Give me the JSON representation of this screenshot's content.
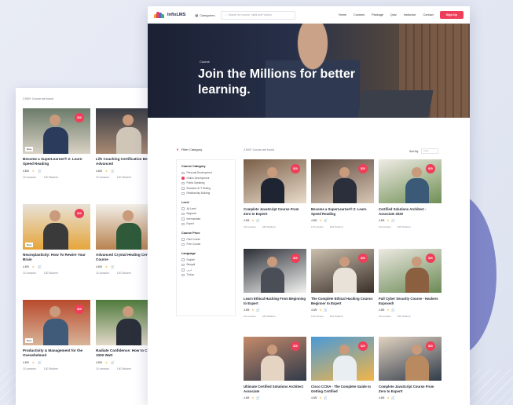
{
  "brand": {
    "name": "InfixLMS",
    "accent": "#ef3e59"
  },
  "nav": {
    "categories_label": "Categories",
    "search_placeholder": "Search for course, skills and Videos",
    "links": [
      "Home",
      "Courses",
      "Package",
      "Quiz",
      "Instructor",
      "Contact"
    ],
    "signup_label": "Sign Up"
  },
  "hero": {
    "subtitle": "Course",
    "title": "Join the Millions for better learning."
  },
  "filter": {
    "heading": "Filter Category",
    "groups": [
      {
        "title": "Course Category",
        "options": [
          "Personal Development",
          "Online Development",
          "Public Speaking",
          "Business & IT Writing",
          "Relationship Building"
        ]
      },
      {
        "title": "Level",
        "options": [
          "All Level",
          "Beginner",
          "Intermediate",
          "Expert"
        ]
      },
      {
        "title": "Course Price",
        "options": [
          "Paid Course",
          "Free Course"
        ]
      },
      {
        "title": "Language",
        "options": [
          "English",
          "Bengali",
          "عربي",
          "Turkçe"
        ]
      }
    ]
  },
  "front": {
    "count_text": "2,500+ Course are found",
    "sort_label": "Sort By",
    "sort_value": "Date",
    "courses": [
      {
        "title": "Complete JavaScript Course From Zero to Expert!",
        "rating": "4.8/5",
        "lessons": "10 Lessons",
        "students": "100 Student"
      },
      {
        "title": "Become a SuperLearner® 2: Learn Speed Reading",
        "rating": "4.8/5",
        "lessons": "10 Lessons",
        "students": "100 Student"
      },
      {
        "title": "Certified Solutions Architect - Associate 2020",
        "rating": "4.8/5",
        "lessons": "10 Lessons",
        "students": "100 Student"
      },
      {
        "title": "Learn Ethical Hacking From Beginning to Expert",
        "rating": "4.8/5",
        "lessons": "10 Lessons",
        "students": "100 Student"
      },
      {
        "title": "The Complete Ethical Hacking Course: Beginner to Expert",
        "rating": "4.8/5",
        "lessons": "10 Lessons",
        "students": "100 Student"
      },
      {
        "title": "Full Cyber Security Course - Hackers Exposed!",
        "rating": "4.8/5",
        "lessons": "10 Lessons",
        "students": "100 Student"
      },
      {
        "title": "Ultimate Certified Solutions Architect Associate",
        "rating": "4.8/5",
        "lessons": "",
        "students": ""
      },
      {
        "title": "Cisco CCNA - The Complete Guide to Getting Certified",
        "rating": "4.8/5",
        "lessons": "",
        "students": ""
      },
      {
        "title": "Complete JavaScript Course From Zero to Expert!",
        "rating": "4.8/5",
        "lessons": "",
        "students": ""
      }
    ]
  },
  "back": {
    "count_text": "2,500+ Course are found",
    "courses": [
      {
        "title": "Become a SuperLearner® 2: Learn Speed Reading",
        "tag": "Beta",
        "rating": "4.8/5",
        "lessons": "10 Lessons",
        "students": "100 Student"
      },
      {
        "title": "Life Coaching Certification Beginner to Advanced",
        "tag": "",
        "rating": "4.8/5",
        "lessons": "10 Lessons",
        "students": "100 Student"
      },
      {
        "title": "Neuroplasticity: How To Rewire Your Brain",
        "tag": "Beta",
        "rating": "4.8/5",
        "lessons": "10 Lessons",
        "students": "100 Student"
      },
      {
        "title": "Advanced Crystal Healing Certificate Course",
        "tag": "",
        "rating": "4.8/5",
        "lessons": "10 Lessons",
        "students": "100 Student"
      },
      {
        "title": "Productivity & Management for the Overwhelmed",
        "tag": "Beta",
        "rating": "4.8/5",
        "lessons": "10 Lessons",
        "students": "100 Student"
      },
      {
        "title": "Radiate Confidence: How to Create a 1000 Watt",
        "tag": "",
        "rating": "4.8/5",
        "lessons": "10 Lessons",
        "students": "100 Student"
      }
    ],
    "price_badge": "$20"
  },
  "price_badge": "$20"
}
